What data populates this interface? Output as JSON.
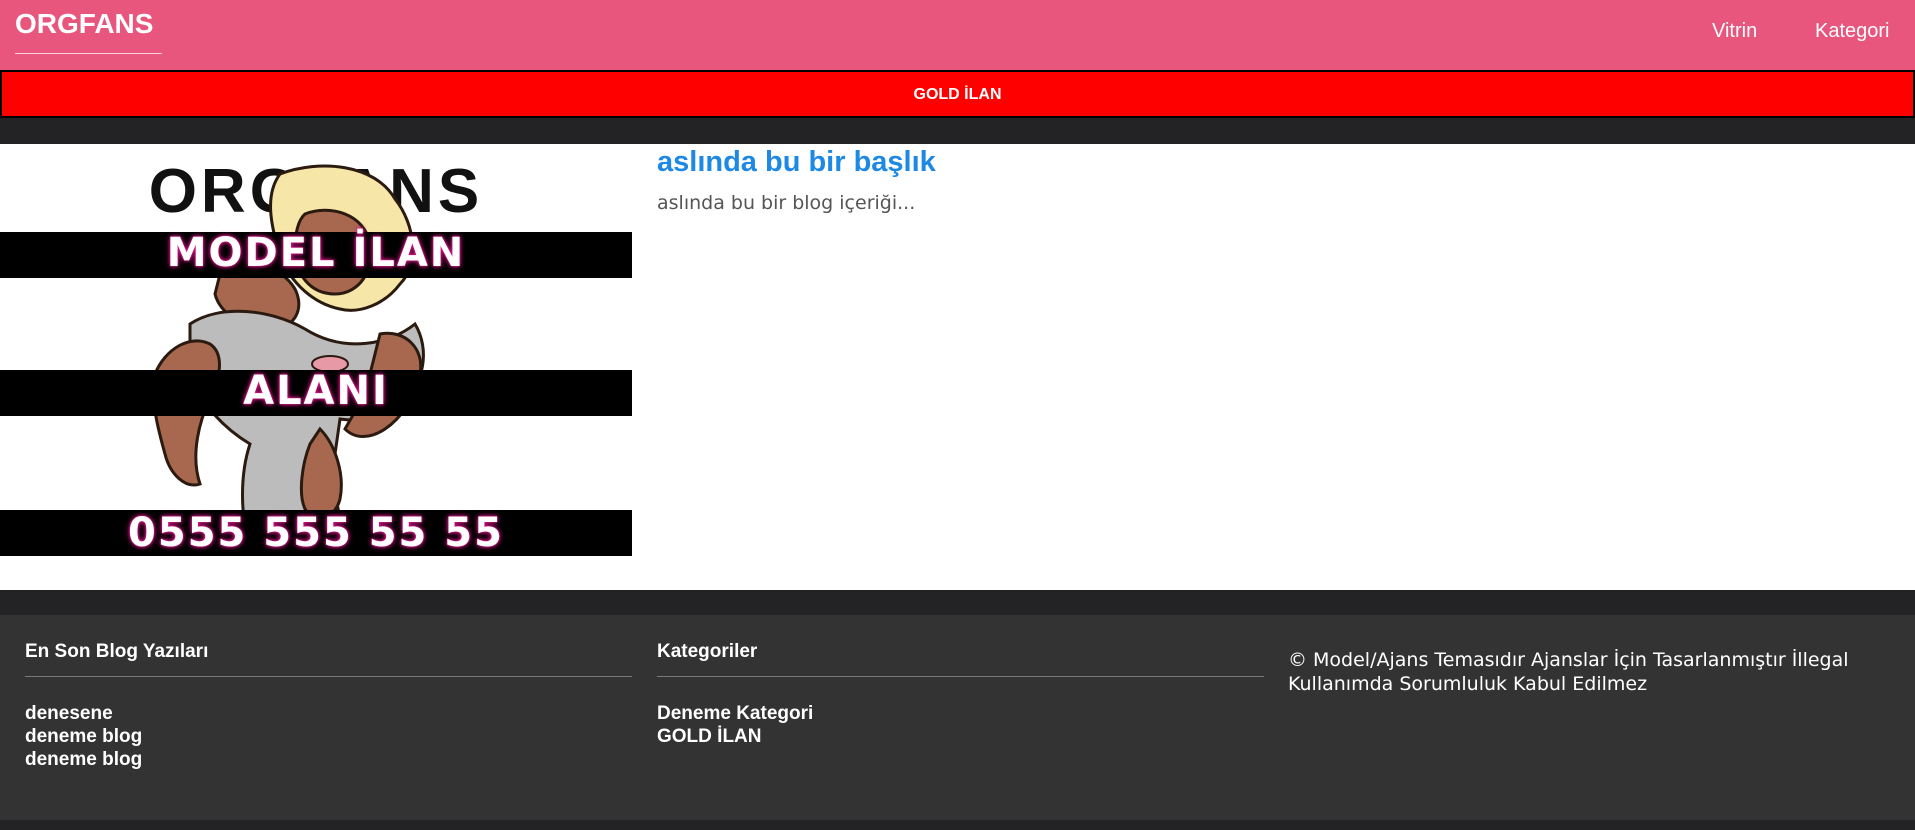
{
  "header": {
    "brand": "ORGFANS",
    "nav": [
      {
        "label": "Vitrin"
      },
      {
        "label": "Kategori"
      }
    ],
    "color": "#e8557d"
  },
  "banner": {
    "label": "GOLD İLAN",
    "color": "#ff0000"
  },
  "promo": {
    "brand": "ORGFANS",
    "line1": "MODEL İLAN",
    "line2": "ALANI",
    "phone": "0555 555 55 55"
  },
  "post": {
    "title": "aslında bu bir başlık",
    "body": "aslında bu bir blog içeriği...",
    "title_color": "#1e88e5"
  },
  "footer": {
    "latest": {
      "heading": "En Son Blog Yazıları",
      "items": [
        "denesene",
        "deneme blog",
        "deneme blog"
      ]
    },
    "categories": {
      "heading": "Kategoriler",
      "items": [
        "Deneme Kategori",
        "GOLD İLAN"
      ]
    },
    "copyright": "© Model/Ajans Temasıdır Ajanslar İçin Tasarlanmıştır İllegal Kullanımda Sorumluluk Kabul Edilmez"
  }
}
